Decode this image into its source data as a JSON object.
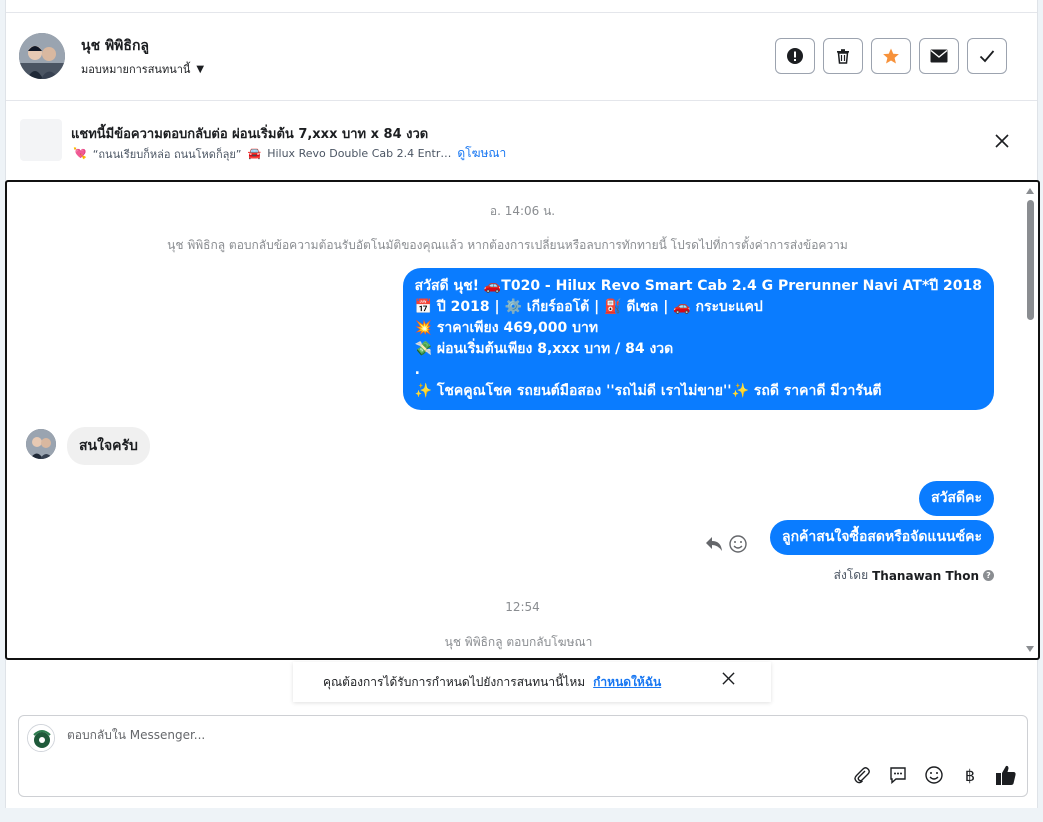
{
  "header": {
    "contact_name": "นุช พิพิธิกลู",
    "assign_label": "มอบหมายการสนทนานี้"
  },
  "ad": {
    "title": "แชทนี้มีข้อความตอบกลับต่อ ผ่อนเริ่มต้น 7,xxx บาท x 84 งวด",
    "subtitle": "“ถนนเรียบก็หล่อ ถนนโหดก็ลุย”",
    "product": "Hilux Revo Double Cab 2.4 Entr…",
    "link": "ดูโฆษณา"
  },
  "chat": {
    "time1": "อ. 14:06 น.",
    "system_notice": "นุช พิพิธิกลู ตอบกลับข้อความต้อนรับอัตโนมัติของคุณแล้ว หากต้องการเปลี่ยนหรือลบการทักทายนี้ โปรดไปที่การตั้งค่าการส่งข้อความ",
    "welcome_lines": [
      "สวัสดี นุช! 🚗T020 - Hilux Revo Smart Cab 2.4 G Prerunner Navi AT*ปี 2018",
      "📅 ปี 2018 | ⚙️ เกียร์ออโต้ | ⛽ ดีเซล | 🚗 กระบะแคป",
      "💥 ราคาเพียง 469,000 บาท",
      "💸 ผ่อนเริ่มต้นเพียง 8,xxx บาท / 84 งวด",
      ".",
      "✨ โชคคูณโชค รถยนต์มือสอง ''รถไม่ดี เราไม่ขาย''✨ รถดี ราคาดี มีวารันตี"
    ],
    "incoming_msg": "สนใจครับ",
    "outgoing_msg1": "สวัสดีคะ",
    "outgoing_msg2": "ลูกค้าสนใจซื้อสดหรือจัดแนนซ์คะ",
    "sent_by_prefix": "ส่งโดย",
    "sent_by_name": "Thanawan Thon",
    "time2": "12:54",
    "reply_ad_notice": "นุช พิพิธิกลู ตอบกลับโฆษณา"
  },
  "assign_toast": {
    "text": "คุณต้องการได้รับการกำหนดไปยังการสนทนานี้ไหม",
    "action": "กำหนดให้ฉัน"
  },
  "composer": {
    "placeholder": "ตอบกลับใน Messenger..."
  },
  "colors": {
    "accent": "#0a7cff",
    "star": "#f7923b",
    "link": "#1877f2"
  },
  "icons": [
    "alert-icon",
    "trash-icon",
    "star-icon",
    "mail-icon",
    "check-icon",
    "close-icon",
    "reply-icon",
    "emoji-icon",
    "attach-icon",
    "saved-reply-icon",
    "baht-icon",
    "like-icon"
  ]
}
